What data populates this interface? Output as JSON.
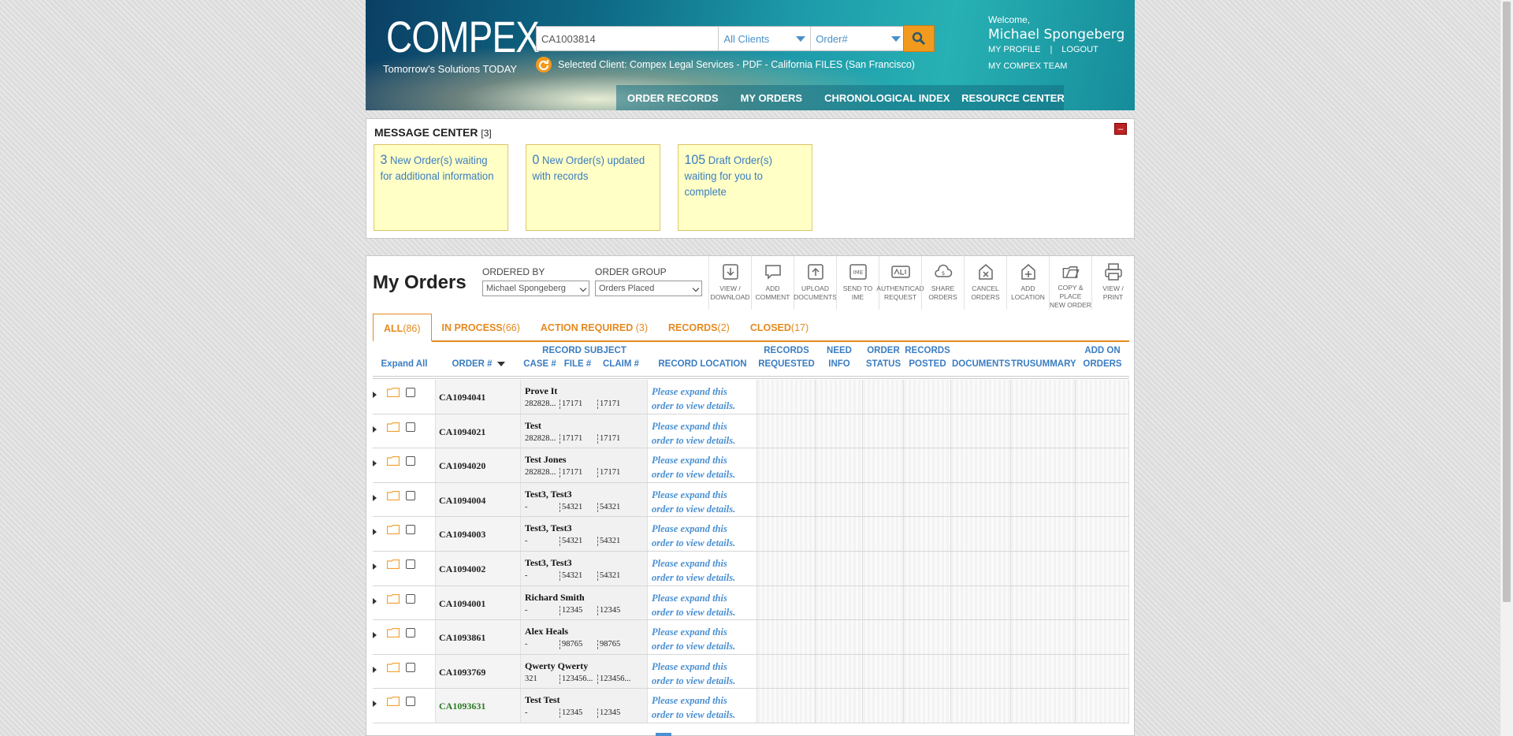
{
  "header": {
    "logo": "COMPEX",
    "tagline": "Tomorrow's Solutions TODAY",
    "search_value": "CA1003814",
    "client_select": "All Clients",
    "field_select": "Order#",
    "selected_client": "Selected Client: Compex Legal Services - PDF - California FILES (San Francisco)",
    "welcome": "Welcome,",
    "username": "Michael Spongeberg",
    "my_profile": "MY PROFILE",
    "separator": "|",
    "logout": "LOGOUT",
    "my_team": "MY COMPEX TEAM",
    "nav": [
      "ORDER RECORDS",
      "MY ORDERS",
      "CHRONOLOGICAL INDEX",
      "RESOURCE CENTER"
    ]
  },
  "message_center": {
    "title": "MESSAGE CENTER",
    "count": "[3]",
    "close": "–",
    "cards": [
      {
        "num": "3",
        "text": "New Order(s) waiting for additional information"
      },
      {
        "num": "0",
        "text": "New Order(s) updated with records"
      },
      {
        "num": "105",
        "text": "Draft Order(s) waiting for you to complete"
      }
    ]
  },
  "orders": {
    "title": "My Orders",
    "ordered_by_label": "ORDERED BY",
    "ordered_by_value": "Michael Spongeberg",
    "order_group_label": "ORDER GROUP",
    "order_group_value": "Orders Placed",
    "toolbar": [
      {
        "icon": "download-icon",
        "label": "VIEW /\nDOWNLOAD"
      },
      {
        "icon": "comment-icon",
        "label": "ADD\nCOMMENT"
      },
      {
        "icon": "upload-icon",
        "label": "UPLOAD\nDOCUMENTS"
      },
      {
        "icon": "ime-icon",
        "label": "SEND TO\nIME"
      },
      {
        "icon": "authenticated-request-icon",
        "label": "AUTHENTICAD\nREQUEST"
      },
      {
        "icon": "share-icon",
        "label": "SHARE\nORDERS"
      },
      {
        "icon": "cancel-orders-icon",
        "label": "CANCEL\nORDERS"
      },
      {
        "icon": "add-location-icon",
        "label": "ADD\nLOCATION"
      },
      {
        "icon": "copy-order-icon",
        "label": "COPY & PLACE\nNEW ORDER"
      },
      {
        "icon": "print-icon",
        "label": "VIEW /\nPRINT"
      }
    ],
    "tabs": [
      {
        "label": "ALL",
        "count": "(86)"
      },
      {
        "label": "IN PROCESS",
        "count": "(66)"
      },
      {
        "label": "ACTION REQUIRED",
        "count": " (3)"
      },
      {
        "label": "RECORDS",
        "count": "(2)"
      },
      {
        "label": "CLOSED",
        "count": "(17)"
      }
    ],
    "columns": {
      "expand_all": "Expand All",
      "order_num": "ORDER #",
      "record_subject": "RECORD SUBJECT",
      "case": "CASE #",
      "file": "FILE #",
      "claim": "CLAIM #",
      "record_location": "RECORD LOCATION",
      "records_requested": "RECORDS REQUESTED",
      "need_info": "NEED INFO",
      "order_status": "ORDER STATUS",
      "records_posted": "RECORDS POSTED",
      "documents": "DOCUMENTS",
      "trusummary": "TRUSUMMARY",
      "add_on_orders": "ADD ON ORDERS"
    },
    "location_placeholder": "Please expand this\norder to view details.",
    "rows": [
      {
        "order": "CA1094041",
        "subject": "Prove It",
        "case": "282828...",
        "file": "17171",
        "claim": "17171"
      },
      {
        "order": "CA1094021",
        "subject": "Test",
        "case": "282828...",
        "file": "17171",
        "claim": "17171"
      },
      {
        "order": "CA1094020",
        "subject": "Test Jones",
        "case": "282828...",
        "file": "17171",
        "claim": "17171"
      },
      {
        "order": "CA1094004",
        "subject": "Test3, Test3",
        "case": "-",
        "file": "54321",
        "claim": "54321"
      },
      {
        "order": "CA1094003",
        "subject": "Test3, Test3",
        "case": "-",
        "file": "54321",
        "claim": "54321"
      },
      {
        "order": "CA1094002",
        "subject": "Test3, Test3",
        "case": "-",
        "file": "54321",
        "claim": "54321"
      },
      {
        "order": "CA1094001",
        "subject": "Richard Smith",
        "case": "-",
        "file": "12345",
        "claim": "12345"
      },
      {
        "order": "CA1093861",
        "subject": "Alex Heals",
        "case": "-",
        "file": "98765",
        "claim": "98765"
      },
      {
        "order": "CA1093769",
        "subject": "Qwerty Qwerty",
        "case": "321",
        "file": "123456...",
        "claim": "123456..."
      },
      {
        "order": "CA1093631",
        "subject": "Test Test",
        "case": "-",
        "file": "12345",
        "claim": "12345",
        "highlight": true
      }
    ]
  }
}
